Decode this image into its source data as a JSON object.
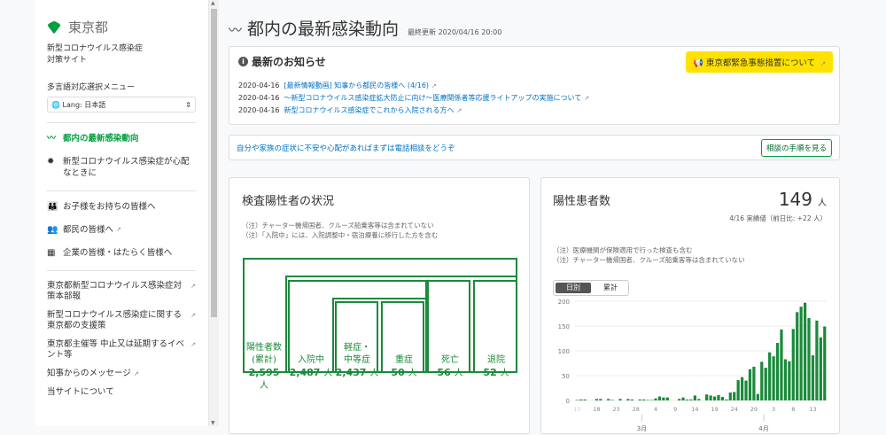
{
  "sidebar": {
    "logo": "東京都",
    "site_name_1": "新型コロナウイルス感染症",
    "site_name_2": "対策サイト",
    "lang_label": "多言語対応選択メニュー",
    "lang_value": "Lang: 日本語",
    "nav": [
      {
        "label": "都内の最新感染動向",
        "icon": "chart-line-icon"
      },
      {
        "label": "新型コロナウイルス感染症が心配なときに",
        "icon": "virus-icon"
      },
      {
        "label": "お子様をお持ちの皆様へ",
        "icon": "parent-child-icon"
      },
      {
        "label": "都民の皆様へ",
        "icon": "people-icon"
      },
      {
        "label": "企業の皆様・はたらく皆様へ",
        "icon": "building-icon"
      }
    ],
    "links": [
      "東京都新型コロナウイルス感染症対策本部報",
      "新型コロナウイルス感染症に関する東京都の支援策",
      "東京都主催等 中止又は延期するイベント等",
      "知事からのメッセージ",
      "当サイトについて"
    ]
  },
  "header": {
    "title": "都内の最新感染動向",
    "updated": "最終更新 2020/04/16 20:00"
  },
  "notice": {
    "title": "最新のお知らせ",
    "emergency": "東京都緊急事態措置について",
    "items": [
      {
        "date": "2020-04-16",
        "text": "[最新情報動画] 知事から都民の皆様へ (4/16)"
      },
      {
        "date": "2020-04-16",
        "text": "～新型コロナウイルス感染症拡大防止に向け～医療関係者等応援ライトアップの実施について"
      },
      {
        "date": "2020-04-16",
        "text": "新型コロナウイルス感染症でこれから入院される方へ"
      }
    ]
  },
  "consult": {
    "text": "自分や家族の症状に不安や心配があればまずは電話相談をどうぞ",
    "button": "相談の手順を見る"
  },
  "status": {
    "title": "検査陽性者の状況",
    "notes": [
      "（注）チャーター機帰国者、クルーズ船乗客等は含まれていない",
      "（注）「入院中」には、入院調整中・宿泊療養に移行した方を含む"
    ],
    "unit": "人",
    "boxes": [
      {
        "label1": "陽性者数",
        "label2": "(累計)",
        "value": "2,595"
      },
      {
        "label1": "入院中",
        "label2": "",
        "value": "2,487"
      },
      {
        "label1": "軽症・",
        "label2": "中等症",
        "value": "2,437"
      },
      {
        "label1": "重症",
        "label2": "",
        "value": "50"
      },
      {
        "label1": "死亡",
        "label2": "",
        "value": "56"
      },
      {
        "label1": "退院",
        "label2": "",
        "value": "52"
      }
    ]
  },
  "patients": {
    "title": "陽性患者数",
    "value": "149",
    "unit": "人",
    "sub": "4/16 実績値（前日比: +22 人）",
    "notes": [
      "（注）医療機関が保険適用で行った検査も含む",
      "（注）チャーター機帰国者、クルーズ船乗客等は含まれていない"
    ],
    "toggle": [
      "日別",
      "累計"
    ]
  },
  "chart_data": {
    "type": "bar",
    "title": "陽性患者数",
    "ylim": [
      0,
      200
    ],
    "yticks": [
      0,
      50,
      100,
      150,
      200
    ],
    "x_start": "2020-02-13",
    "x_end": "2020-04-16",
    "xtick_labels": [
      "13",
      "18",
      "23",
      "28",
      "4",
      "9",
      "14",
      "19",
      "24",
      "29",
      "3",
      "8",
      "13"
    ],
    "month_labels": [
      "3月",
      "4月"
    ],
    "values": [
      1,
      2,
      2,
      0,
      0,
      3,
      3,
      0,
      3,
      1,
      0,
      3,
      0,
      3,
      2,
      0,
      2,
      2,
      1,
      1,
      4,
      8,
      6,
      6,
      0,
      0,
      3,
      6,
      2,
      2,
      10,
      3,
      0,
      12,
      10,
      8,
      11,
      7,
      2,
      16,
      17,
      41,
      47,
      40,
      63,
      68,
      13,
      78,
      66,
      97,
      89,
      116,
      143,
      83,
      79,
      144,
      178,
      189,
      197,
      166,
      91,
      161,
      127,
      149
    ],
    "color": "#1b8a3b"
  }
}
